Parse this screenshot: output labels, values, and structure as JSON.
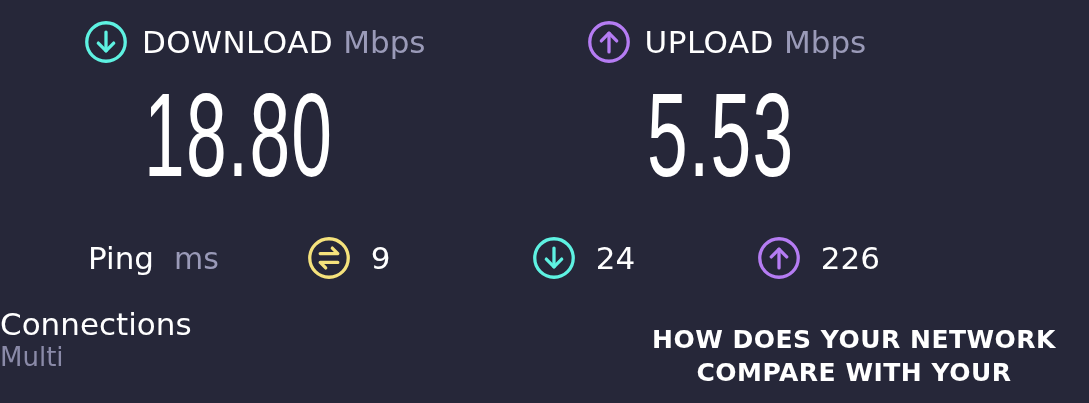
{
  "results": [
    {
      "kind": "download",
      "label": "DOWNLOAD",
      "unit": "Mbps",
      "value": "18.80"
    },
    {
      "kind": "upload",
      "label": "UPLOAD",
      "unit": "Mbps",
      "value": "5.53"
    }
  ],
  "ping": {
    "label": "Ping",
    "unit": "ms",
    "readings": [
      {
        "kind": "ping",
        "value": "9"
      },
      {
        "kind": "download",
        "value": "24"
      },
      {
        "kind": "upload",
        "value": "226"
      }
    ]
  },
  "connections": {
    "label": "Connections",
    "value": "Multi"
  },
  "compare": {
    "lines": [
      "HOW DOES YOUR NETWORK",
      "COMPARE WITH YOUR"
    ]
  }
}
